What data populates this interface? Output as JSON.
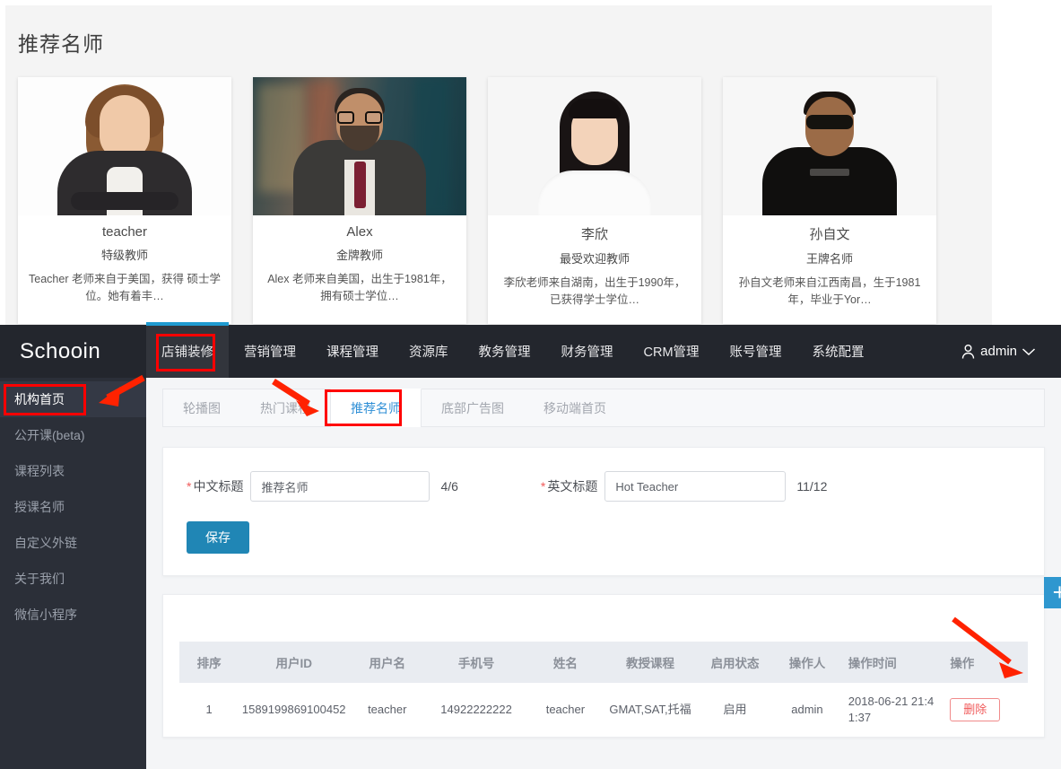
{
  "preview": {
    "title": "推荐名师",
    "teachers": [
      {
        "name": "teacher",
        "rank": "特级教师",
        "desc": "Teacher 老师来自于美国，获得 硕士学位。她有着丰…",
        "photo": "woman-portrait-photo"
      },
      {
        "name": "Alex",
        "rank": "金牌教师",
        "desc": "Alex 老师来自美国，出生于1981年，拥有硕士学位…",
        "photo": "bearded-man-cafe-photo"
      },
      {
        "name": "李欣",
        "rank": "最受欢迎教师",
        "desc": "李欣老师来自湖南，出生于1990年，已获得学士学位…",
        "photo": "asian-woman-portrait-photo"
      },
      {
        "name": "孙自文",
        "rank": "王牌名师",
        "desc": "孙自文老师来自江西南昌，生于1981年，毕业于Yor…",
        "photo": "man-sunglasses-portrait-photo"
      }
    ]
  },
  "topnav": {
    "brand": "Schooin",
    "items": [
      {
        "label": "店铺装修",
        "active": true
      },
      {
        "label": "营销管理",
        "active": false
      },
      {
        "label": "课程管理",
        "active": false
      },
      {
        "label": "资源库",
        "active": false
      },
      {
        "label": "教务管理",
        "active": false
      },
      {
        "label": "财务管理",
        "active": false
      },
      {
        "label": "CRM管理",
        "active": false
      },
      {
        "label": "账号管理",
        "active": false
      },
      {
        "label": "系统配置",
        "active": false
      }
    ],
    "user": "admin",
    "user_icon": "person-icon",
    "caret_icon": "chevron-down-icon"
  },
  "sidebar": {
    "items": [
      {
        "label": "机构首页",
        "active": true
      },
      {
        "label": "公开课(beta)",
        "active": false
      },
      {
        "label": "课程列表",
        "active": false
      },
      {
        "label": "授课名师",
        "active": false
      },
      {
        "label": "自定义外链",
        "active": false
      },
      {
        "label": "关于我们",
        "active": false
      },
      {
        "label": "微信小程序",
        "active": false
      }
    ]
  },
  "tabs": [
    {
      "label": "轮播图",
      "active": false
    },
    {
      "label": "热门课程",
      "active": false
    },
    {
      "label": "推荐名师",
      "active": true
    },
    {
      "label": "底部广告图",
      "active": false
    },
    {
      "label": "移动端首页",
      "active": false
    }
  ],
  "form": {
    "zh_label": "中文标题",
    "zh_value": "推荐名师",
    "zh_counter": "4/6",
    "en_label": "英文标题",
    "en_value": "Hot Teacher",
    "en_counter": "11/12",
    "required_mark": "*",
    "save_label": "保存"
  },
  "table": {
    "add_label": "+",
    "columns": [
      "排序",
      "用户ID",
      "用户名",
      "手机号",
      "姓名",
      "教授课程",
      "启用状态",
      "操作人",
      "操作时间",
      "操作"
    ],
    "rows": [
      {
        "order": "1",
        "user_id": "1589199869100452",
        "username": "teacher",
        "phone": "14922222222",
        "realname": "teacher",
        "courses": "GMAT,SAT,托福",
        "status": "启用",
        "operator": "admin",
        "op_time": "2018-06-21 21:41:37",
        "action": "删除"
      }
    ]
  },
  "colors": {
    "accent_blue": "#2f97cf",
    "save_blue": "#2086b5",
    "tab_active_blue": "#2f8fd6",
    "annotation_red": "#ff0000",
    "nav_dark": "#23262d",
    "sidebar_dark": "#2b2f38",
    "delete_red": "#f05a5a"
  }
}
